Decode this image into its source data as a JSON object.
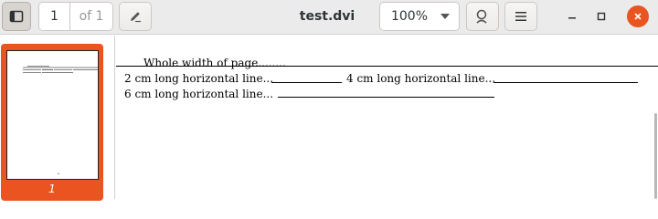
{
  "window": {
    "title": "test.dvi"
  },
  "toolbar": {
    "page_current": "1",
    "page_of": "of 1",
    "zoom": "100%"
  },
  "sidebar": {
    "thumbnail_label": "1",
    "accent_color": "#e95420"
  },
  "document": {
    "line1": "Whole width of page........",
    "line2a": "2 cm long horizontal line...",
    "line2b": "4 cm long horizontal line...",
    "line3": "6 cm long horizontal line..."
  },
  "icons": {
    "sidebar_toggle": "sidebar-toggle-icon",
    "annotate": "pencil-icon",
    "search": "search-icon",
    "menu": "hamburger-menu-icon",
    "minimize": "minimize-icon",
    "maximize": "maximize-icon",
    "close": "close-icon"
  }
}
